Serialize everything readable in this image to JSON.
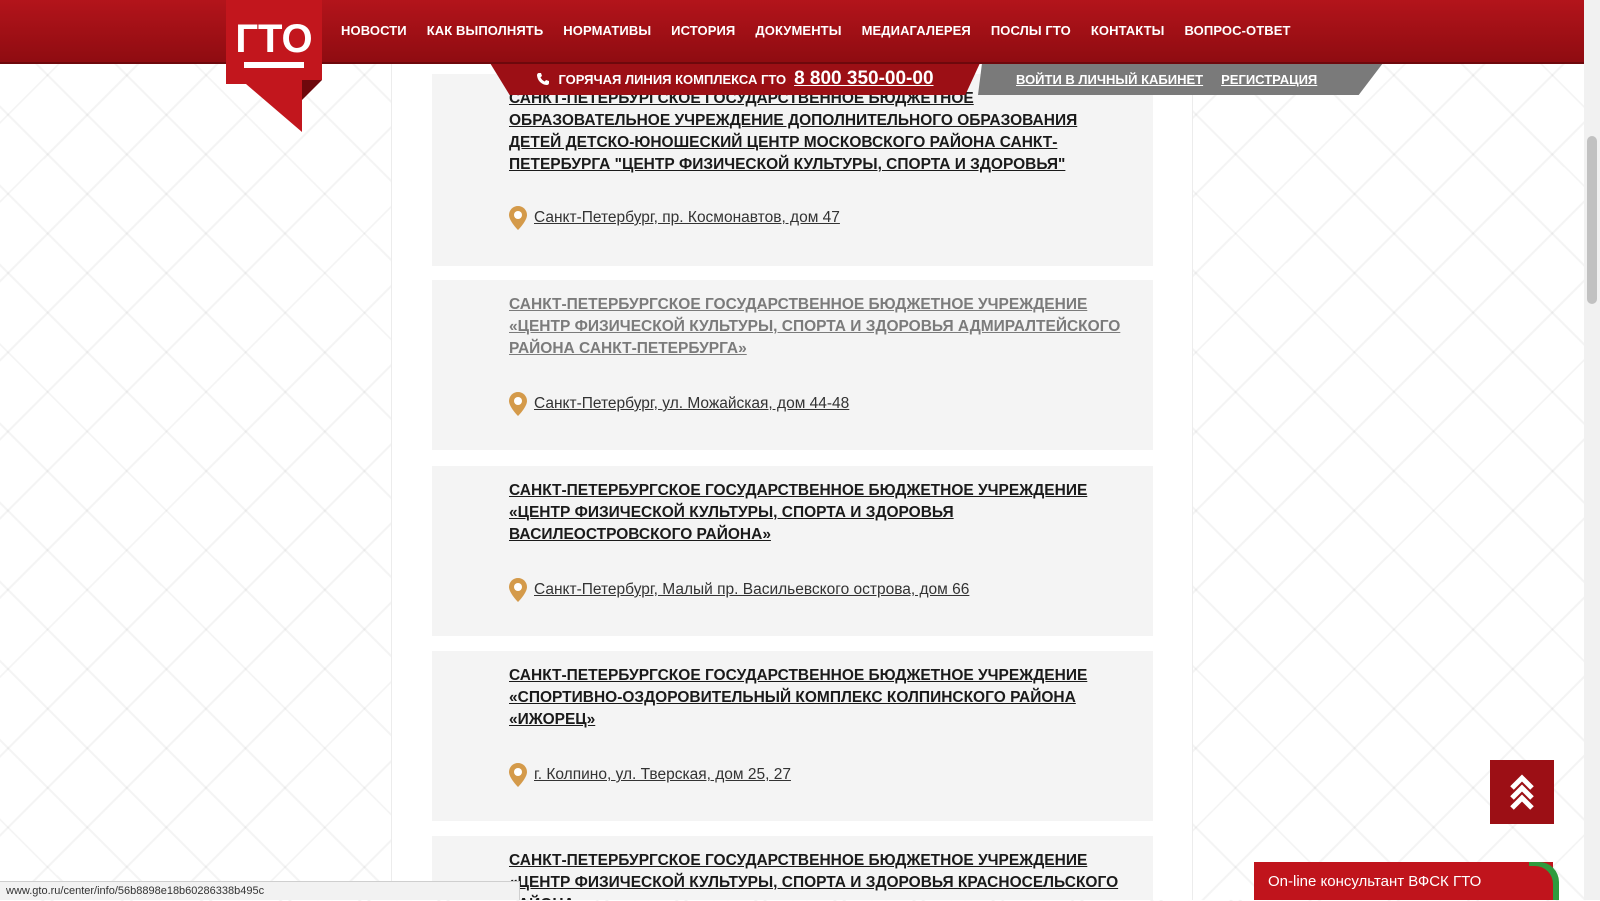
{
  "logo": {
    "text": "ГТО"
  },
  "nav": {
    "items": [
      "НОВОСТИ",
      "КАК ВЫПОЛНЯТЬ",
      "НОРМАТИВЫ",
      "ИСТОРИЯ",
      "ДОКУМЕНТЫ",
      "МЕДИАГАЛЕРЕЯ",
      "ПОСЛЫ ГТО",
      "КОНТАКТЫ",
      "ВОПРОС-ОТВЕТ"
    ]
  },
  "hotline": {
    "label": "ГОРЯЧАЯ ЛИНИЯ КОМПЛЕКСА ГТО",
    "number": "8 800 350-00-00"
  },
  "account": {
    "login": "ВОЙТИ В ЛИЧНЫЙ КАБИНЕТ",
    "register": "РЕГИСТРАЦИЯ"
  },
  "centers": [
    {
      "title": "САНКТ-ПЕТЕРБУРГСКОЕ ГОСУДАРСТВЕННОЕ БЮДЖЕТНОЕ ОБРАЗОВАТЕЛЬНОЕ УЧРЕЖДЕНИЕ ДОПОЛНИТЕЛЬНОГО ОБРАЗОВАНИЯ ДЕТЕЙ ДЕТСКО-ЮНОШЕСКИЙ ЦЕНТР МОСКОВСКОГО РАЙОНА САНКТ-ПЕТЕРБУРГА \"ЦЕНТР ФИЗИЧЕСКОЙ КУЛЬТУРЫ, СПОРТА И ЗДОРОВЬЯ\"",
      "address": "Санкт-Петербург, пр. Космонавтов, дом 47"
    },
    {
      "title": "САНКТ-ПЕТЕРБУРГСКОЕ ГОСУДАРСТВЕННОЕ БЮДЖЕТНОЕ УЧРЕЖДЕНИЕ «ЦЕНТР ФИЗИЧЕСКОЙ КУЛЬТУРЫ, СПОРТА И ЗДОРОВЬЯ АДМИРАЛТЕЙСКОГО РАЙОНА САНКТ-ПЕТЕРБУРГА»",
      "address": "Санкт-Петербург, ул. Можайская, дом 44-48"
    },
    {
      "title": "САНКТ-ПЕТЕРБУРГСКОЕ ГОСУДАРСТВЕННОЕ БЮДЖЕТНОЕ УЧРЕЖДЕНИЕ «ЦЕНТР ФИЗИЧЕСКОЙ КУЛЬТУРЫ, СПОРТА И ЗДОРОВЬЯ ВАСИЛЕОСТРОВСКОГО РАЙОНА»",
      "address": "Санкт-Петербург, Малый пр. Васильевского острова, дом 66"
    },
    {
      "title": "САНКТ-ПЕТЕРБУРГСКОЕ ГОСУДАРСТВЕННОЕ БЮДЖЕТНОЕ УЧРЕЖДЕНИЕ «СПОРТИВНО-ОЗДОРОВИТЕЛЬНЫЙ КОМПЛЕКС КОЛПИНСКОГО РАЙОНА «ИЖОРЕЦ»",
      "address": "г. Колпино, ул. Тверская, дом 25, 27"
    },
    {
      "title": "САНКТ-ПЕТЕРБУРГСКОЕ ГОСУДАРСТВЕННОЕ БЮДЖЕТНОЕ УЧРЕЖДЕНИЕ «ЦЕНТР ФИЗИЧЕСКОЙ КУЛЬТУРЫ, СПОРТА И ЗДОРОВЬЯ КРАСНОСЕЛЬСКОГО РАЙОНА»",
      "address": ""
    }
  ],
  "consultant": {
    "label": "On-line консультант ВФСК ГТО"
  },
  "status_url": "www.gto.ru/center/info/56b8898e18b60286338b495c",
  "colors": {
    "brand_red": "#9c0f15",
    "nav_gradient_top": "#b3141b",
    "card_bg": "#f4f4f4",
    "pin_orange": "#d49a4a",
    "consultant_curl": "#2e9b3e"
  }
}
